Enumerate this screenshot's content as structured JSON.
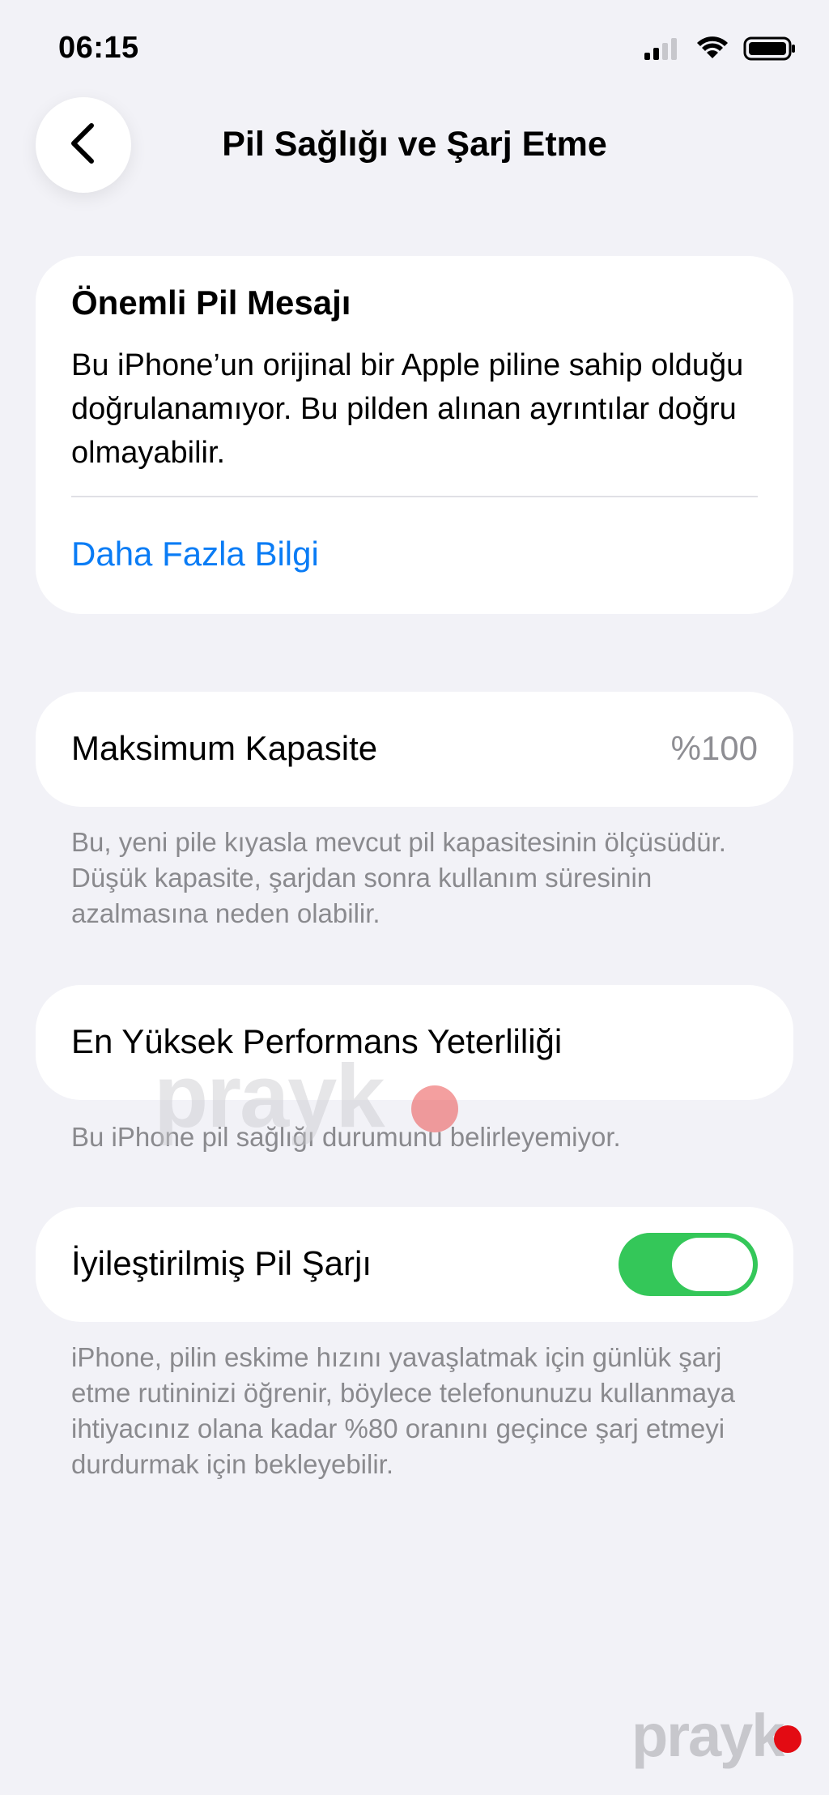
{
  "status_bar": {
    "time": "06:15"
  },
  "nav": {
    "title": "Pil Sağlığı ve Şarj Etme"
  },
  "battery_message": {
    "title": "Önemli Pil Mesajı",
    "body": "Bu iPhone’un orijinal bir Apple piline sahip olduğu doğrulanamıyor. Bu pilden alınan ayrıntılar doğru olmayabilir.",
    "link": "Daha Fazla Bilgi"
  },
  "maximum_capacity": {
    "label": "Maksimum Kapasite",
    "value": "%100",
    "footnote": "Bu, yeni pile kıyasla mevcut pil kapasitesinin ölçüsüdür. Düşük kapasite, şarjdan sonra kullanım süresinin azalmasına neden olabilir."
  },
  "peak_performance": {
    "label": "En Yüksek Performans Yeterliliği",
    "footnote": "Bu iPhone pil sağlığı durumunu belirleyemiyor."
  },
  "optimized_charging": {
    "label": "İyileştirilmiş Pil Şarjı",
    "enabled": true,
    "footnote": "iPhone, pilin eskime hızını yavaşlatmak için günlük şarj etme rutininizi öğrenir, böylece telefonunuzu kullanmaya ihtiyacınız olana kadar %80 oranını geçince şarj etmeyi durdurmak için bekleyebilir."
  },
  "watermark": {
    "text": "prayk"
  },
  "colors": {
    "background": "#f2f2f7",
    "link_blue": "#0a7cf5",
    "toggle_green": "#34c759",
    "watermark_dot": "#e30b13"
  },
  "icons": {
    "back": "chevron-left-icon",
    "signal": "cellular-signal-icon",
    "wifi": "wifi-icon",
    "battery": "battery-icon"
  }
}
